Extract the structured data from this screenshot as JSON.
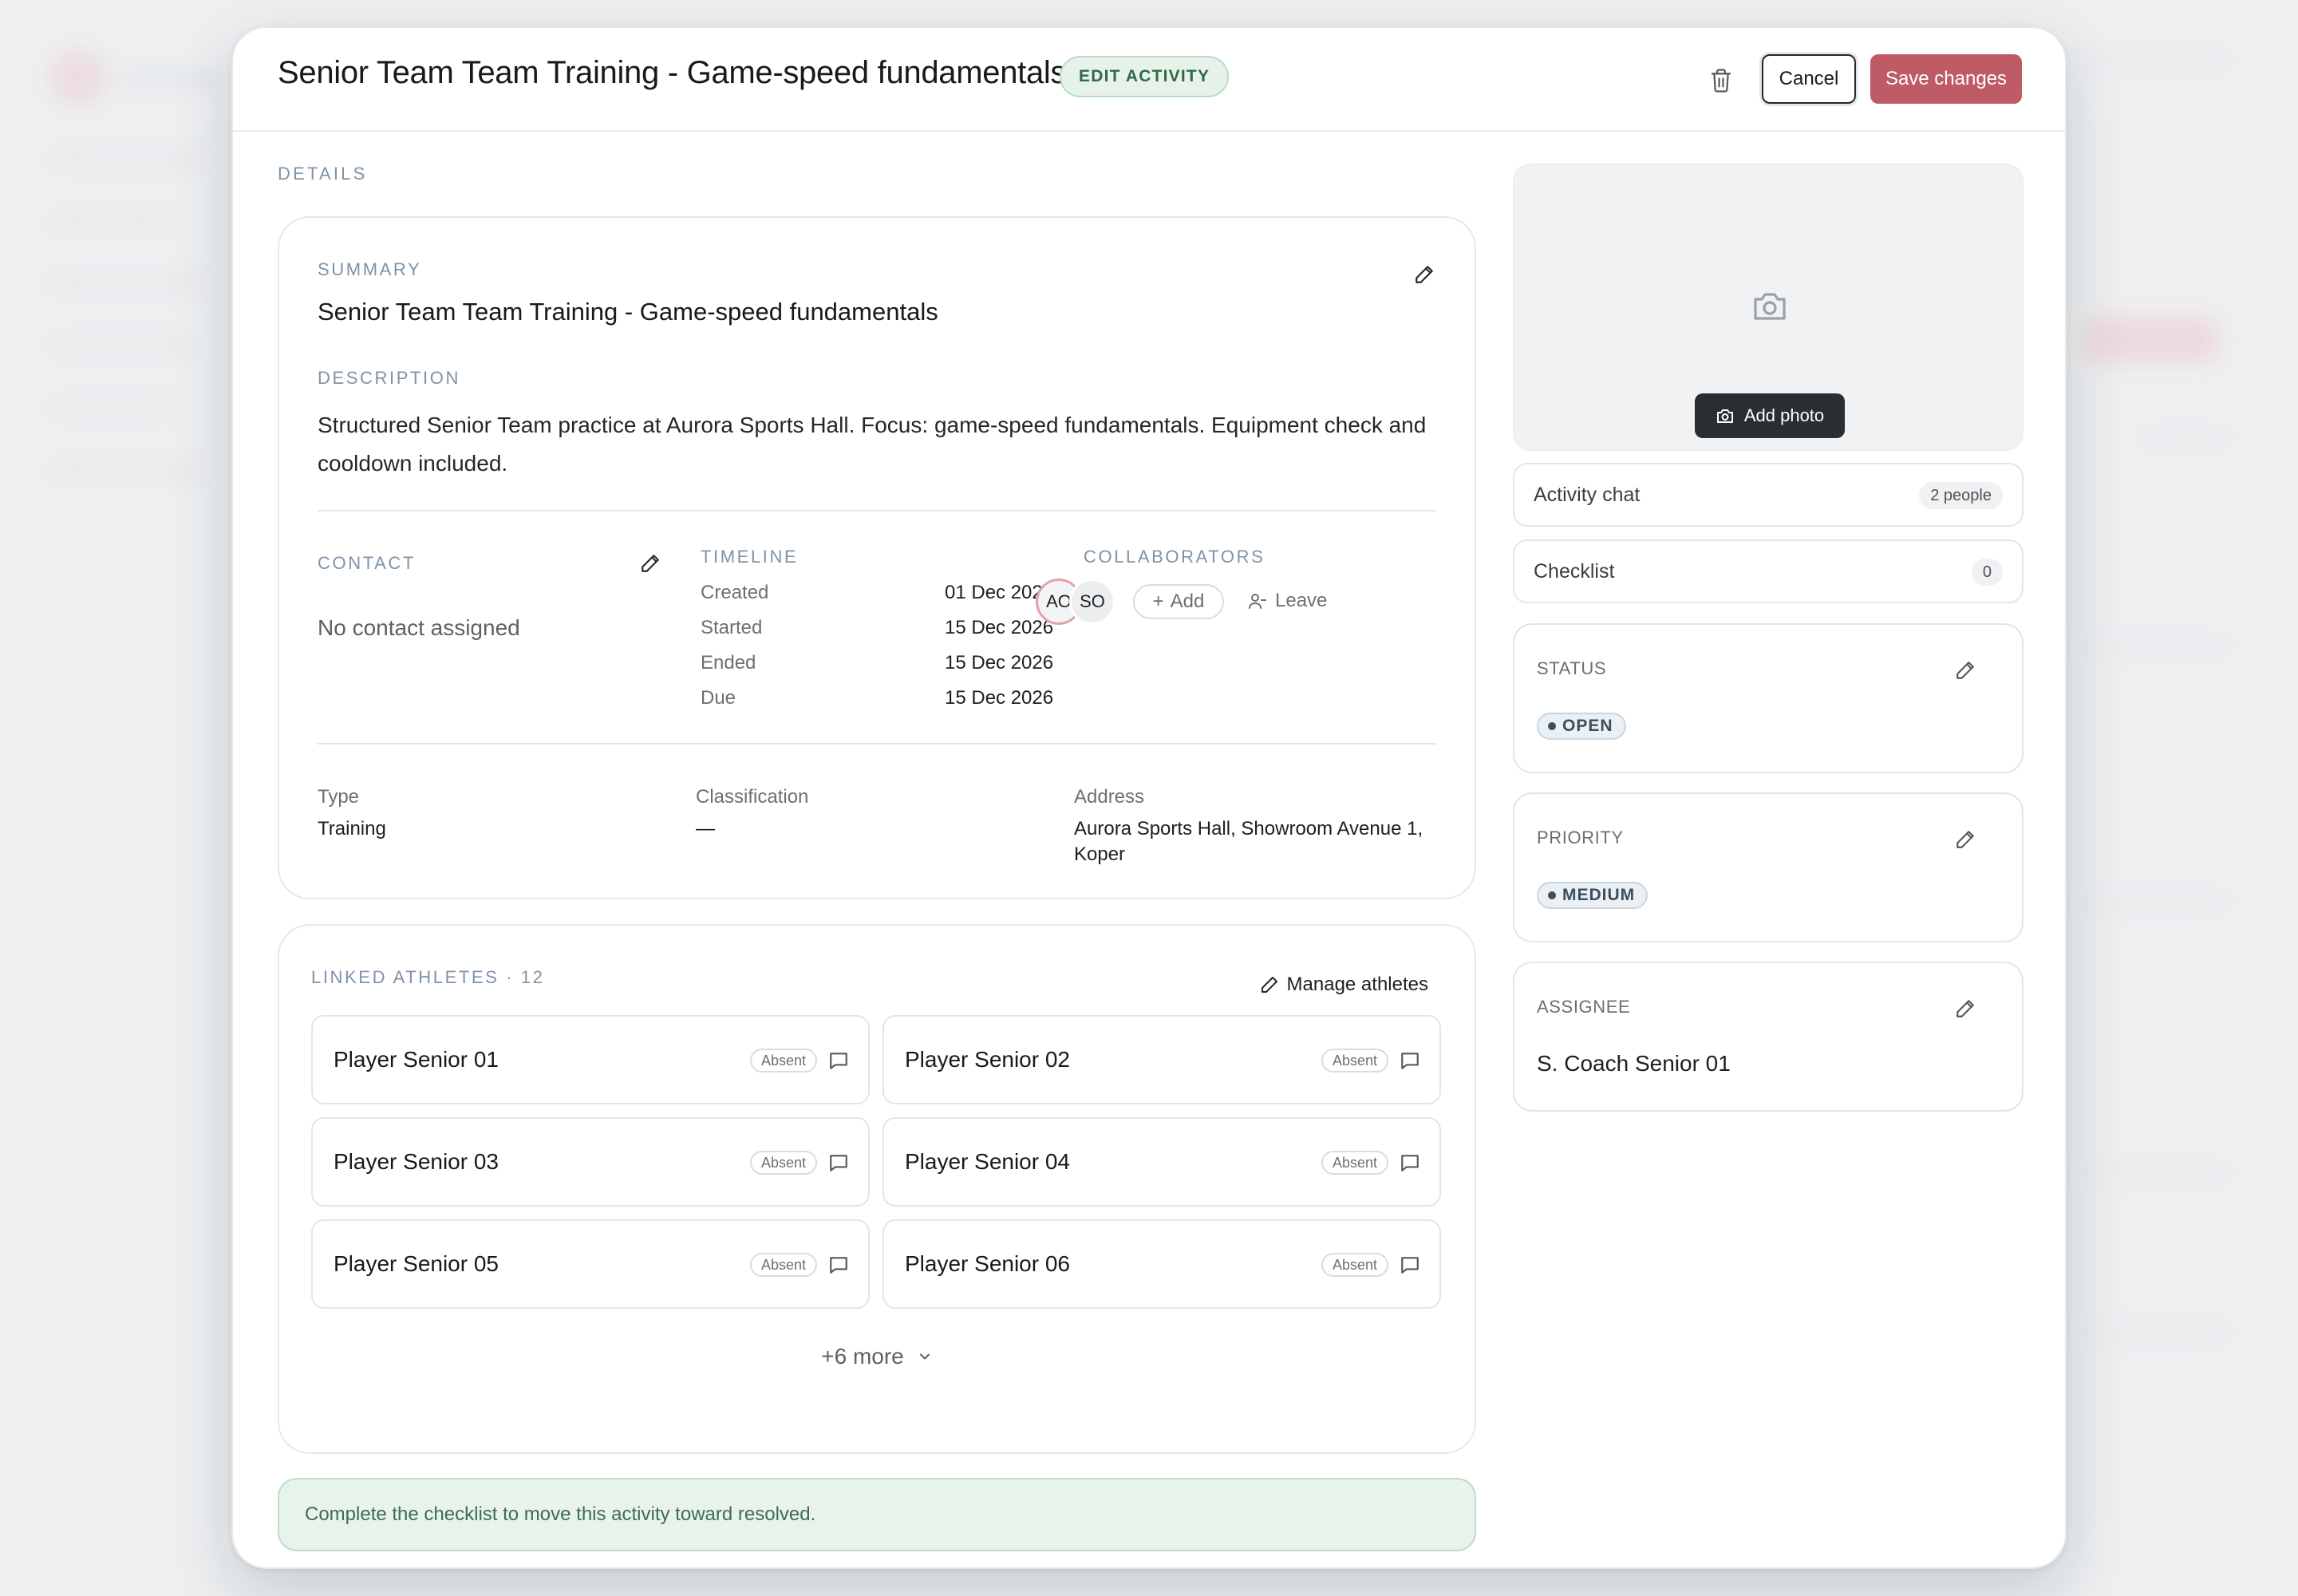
{
  "header": {
    "title": "Senior Team Team Training - Game-speed fundamentals",
    "mode_badge": "EDIT ACTIVITY",
    "cancel_label": "Cancel",
    "save_label": "Save changes",
    "delete_icon": "trash-icon"
  },
  "details": {
    "section_label": "DETAILS",
    "summary_label": "SUMMARY",
    "summary": "Senior Team Team Training - Game-speed fundamentals",
    "description_label": "DESCRIPTION",
    "description": "Structured Senior Team practice at Aurora Sports Hall. Focus: game-speed fundamentals. Equipment check and cooldown included.",
    "contact_label": "CONTACT",
    "contact_value": "No contact assigned",
    "timeline_label": "TIMELINE",
    "timeline": [
      {
        "key": "Created",
        "value": "01 Dec 2026"
      },
      {
        "key": "Started",
        "value": "15 Dec 2026"
      },
      {
        "key": "Ended",
        "value": "15 Dec 2026"
      },
      {
        "key": "Due",
        "value": "15 Dec 2026"
      }
    ],
    "collaborators_label": "COLLABORATORS",
    "collaborators": [
      "AO",
      "SO"
    ],
    "add_label": "Add",
    "leave_label": "Leave",
    "type_key": "Type",
    "type_value": "Training",
    "classification_key": "Classification",
    "classification_value": "—",
    "address_key": "Address",
    "address_value": "Aurora Sports Hall, Showroom Avenue 1, Koper"
  },
  "athletes": {
    "label": "LINKED ATHLETES · 12",
    "manage_label": "Manage athletes",
    "items": [
      {
        "name": "Player Senior 01",
        "status": "Absent"
      },
      {
        "name": "Player Senior 02",
        "status": "Absent"
      },
      {
        "name": "Player Senior 03",
        "status": "Absent"
      },
      {
        "name": "Player Senior 04",
        "status": "Absent"
      },
      {
        "name": "Player Senior 05",
        "status": "Absent"
      },
      {
        "name": "Player Senior 06",
        "status": "Absent"
      }
    ],
    "more_label": "+6 more"
  },
  "hint": "Complete the checklist to move this activity toward resolved.",
  "sidebar": {
    "add_photo_label": "Add photo",
    "activity_chat_label": "Activity chat",
    "activity_chat_count": "2 people",
    "checklist_label": "Checklist",
    "checklist_count": "0",
    "status_label": "STATUS",
    "status_value": "OPEN",
    "priority_label": "PRIORITY",
    "priority_value": "MEDIUM",
    "assignee_label": "ASSIGNEE",
    "assignee_value": "S. Coach Senior 01"
  },
  "colors": {
    "accent": "#bf5b66",
    "badge_green": "#2c6b44",
    "hint_bg": "#e8f3ec"
  }
}
